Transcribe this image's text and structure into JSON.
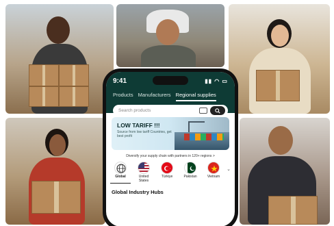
{
  "status": {
    "time": "9:41",
    "icons": "▮▮ ◠ ▭"
  },
  "tabs": [
    {
      "label": "Products",
      "active": false
    },
    {
      "label": "Manufacturers",
      "active": false
    },
    {
      "label": "Regional supplies",
      "active": true
    }
  ],
  "search": {
    "placeholder": "Search products"
  },
  "banner": {
    "title": "LOW TARIFF !!!",
    "subtitle": "Source from low tariff Countries, get best profit"
  },
  "diversify_text": "Diversify your supply chain with partners in 120+ regions >",
  "regions": [
    {
      "label": "Global",
      "icon": "globe-icon",
      "active": true
    },
    {
      "label": "United States",
      "icon": "us-flag",
      "active": false
    },
    {
      "label": "Türkiye",
      "icon": "turkey-flag",
      "active": false
    },
    {
      "label": "Pakistan",
      "icon": "pakistan-flag",
      "active": false
    },
    {
      "label": "Vietnam",
      "icon": "vietnam-flag",
      "active": false
    }
  ],
  "section_title": "Global Industry Hubs",
  "colors": {
    "header": "#0e3b35",
    "accent": "#ffffff"
  }
}
